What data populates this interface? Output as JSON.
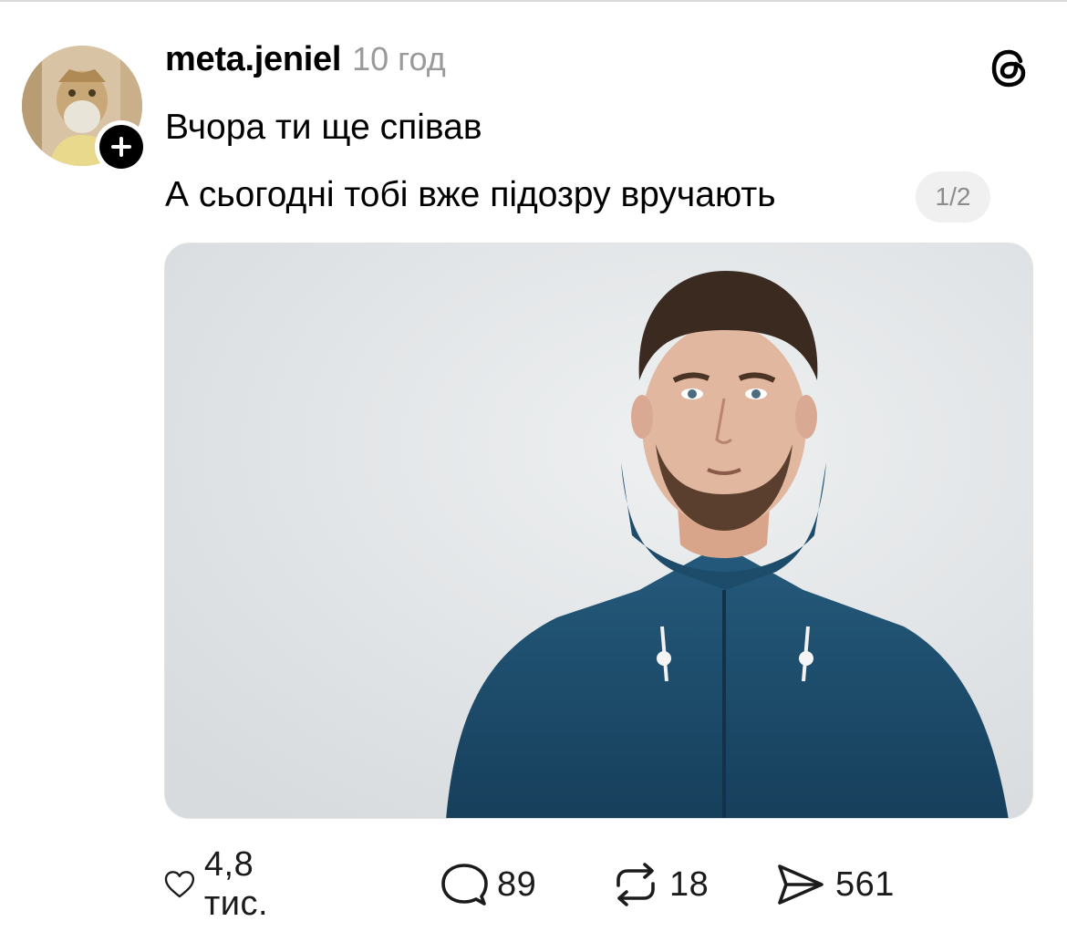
{
  "post": {
    "username": "meta.jeniel",
    "time": "10 год",
    "lines": [
      "Вчора ти ще співав",
      "А сьогодні тобі вже підозру вручають"
    ],
    "page_indicator": "1/2"
  },
  "actions": {
    "likes": "4,8 тис.",
    "comments": "89",
    "reposts": "18",
    "shares": "561"
  },
  "icons": {
    "logo": "threads-logo-icon",
    "follow": "plus-icon",
    "like": "heart-icon",
    "comment": "comment-bubble-icon",
    "repost": "repost-icon",
    "share": "send-icon"
  },
  "colors": {
    "text": "#000000",
    "muted": "#9a9a9a",
    "badge_bg": "#f0f0f0",
    "photo_bg": "#e3e6e8",
    "jacket": "#1e4f6e"
  }
}
